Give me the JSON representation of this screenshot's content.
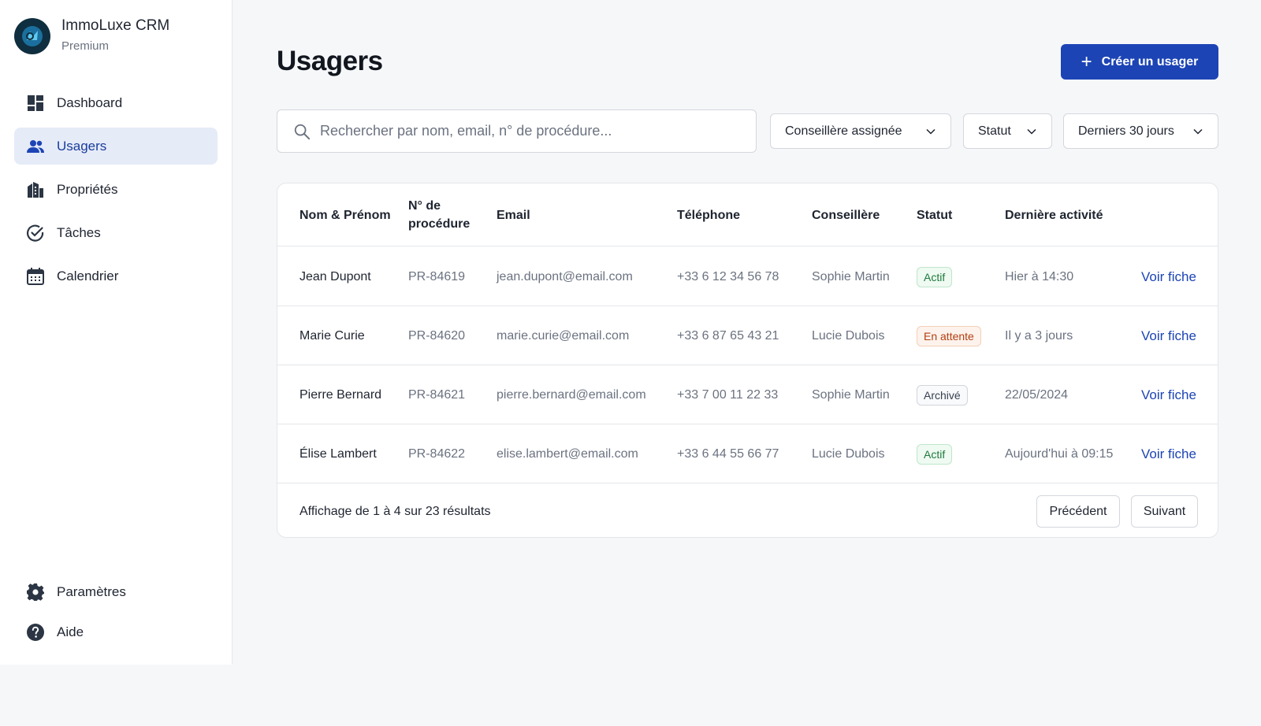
{
  "brand": {
    "name": "ImmoLuxe CRM",
    "plan": "Premium"
  },
  "sidebar": {
    "items": [
      {
        "label": "Dashboard",
        "icon": "dashboard-icon"
      },
      {
        "label": "Usagers",
        "icon": "users-icon",
        "active": true
      },
      {
        "label": "Propriétés",
        "icon": "building-icon"
      },
      {
        "label": "Tâches",
        "icon": "check-circle-icon"
      },
      {
        "label": "Calendrier",
        "icon": "calendar-icon"
      }
    ],
    "bottom": [
      {
        "label": "Paramètres",
        "icon": "gear-icon"
      },
      {
        "label": "Aide",
        "icon": "help-icon"
      }
    ]
  },
  "page": {
    "title": "Usagers",
    "create_label": "Créer un usager"
  },
  "search": {
    "placeholder": "Rechercher par nom, email, n° de procédure..."
  },
  "filters": [
    {
      "label": "Conseillère assignée"
    },
    {
      "label": "Statut"
    },
    {
      "label": "Derniers 30 jours"
    }
  ],
  "table": {
    "headers": [
      "Nom & Prénom",
      "N° de procédure",
      "Email",
      "Téléphone",
      "Conseillère",
      "Statut",
      "Dernière activité"
    ],
    "rows": [
      {
        "name": "Jean Dupont",
        "proc": "PR-84619",
        "email": "jean.dupont@email.com",
        "phone": "+33 6 12 34 56 78",
        "advisor": "Sophie Martin",
        "status": "Actif",
        "activity": "Hier à 14:30",
        "action": "Voir fiche"
      },
      {
        "name": "Marie Curie",
        "proc": "PR-84620",
        "email": "marie.curie@email.com",
        "phone": "+33 6 87 65 43 21",
        "advisor": "Lucie Dubois",
        "status": "En attente",
        "activity": "Il y a 3 jours",
        "action": "Voir fiche"
      },
      {
        "name": "Pierre Bernard",
        "proc": "PR-84621",
        "email": "pierre.bernard@email.com",
        "phone": "+33 7 00 11 22 33",
        "advisor": "Sophie Martin",
        "status": "Archivé",
        "activity": "22/05/2024",
        "action": "Voir fiche"
      },
      {
        "name": "Élise Lambert",
        "proc": "PR-84622",
        "email": "elise.lambert@email.com",
        "phone": "+33 6 44 55 66 77",
        "advisor": "Lucie Dubois",
        "status": "Actif",
        "activity": "Aujourd'hui à 09:15",
        "action": "Voir fiche"
      }
    ]
  },
  "pagination": {
    "summary": "Affichage de 1 à 4 sur 23 résultats",
    "prev_label": "Précédent",
    "next_label": "Suivant"
  },
  "colors": {
    "accent": "#1c44b5",
    "active_nav_bg": "#e6ebf8",
    "status_actif": "#1e7a3c",
    "status_attente": "#b43e12",
    "status_archive": "#374151"
  }
}
